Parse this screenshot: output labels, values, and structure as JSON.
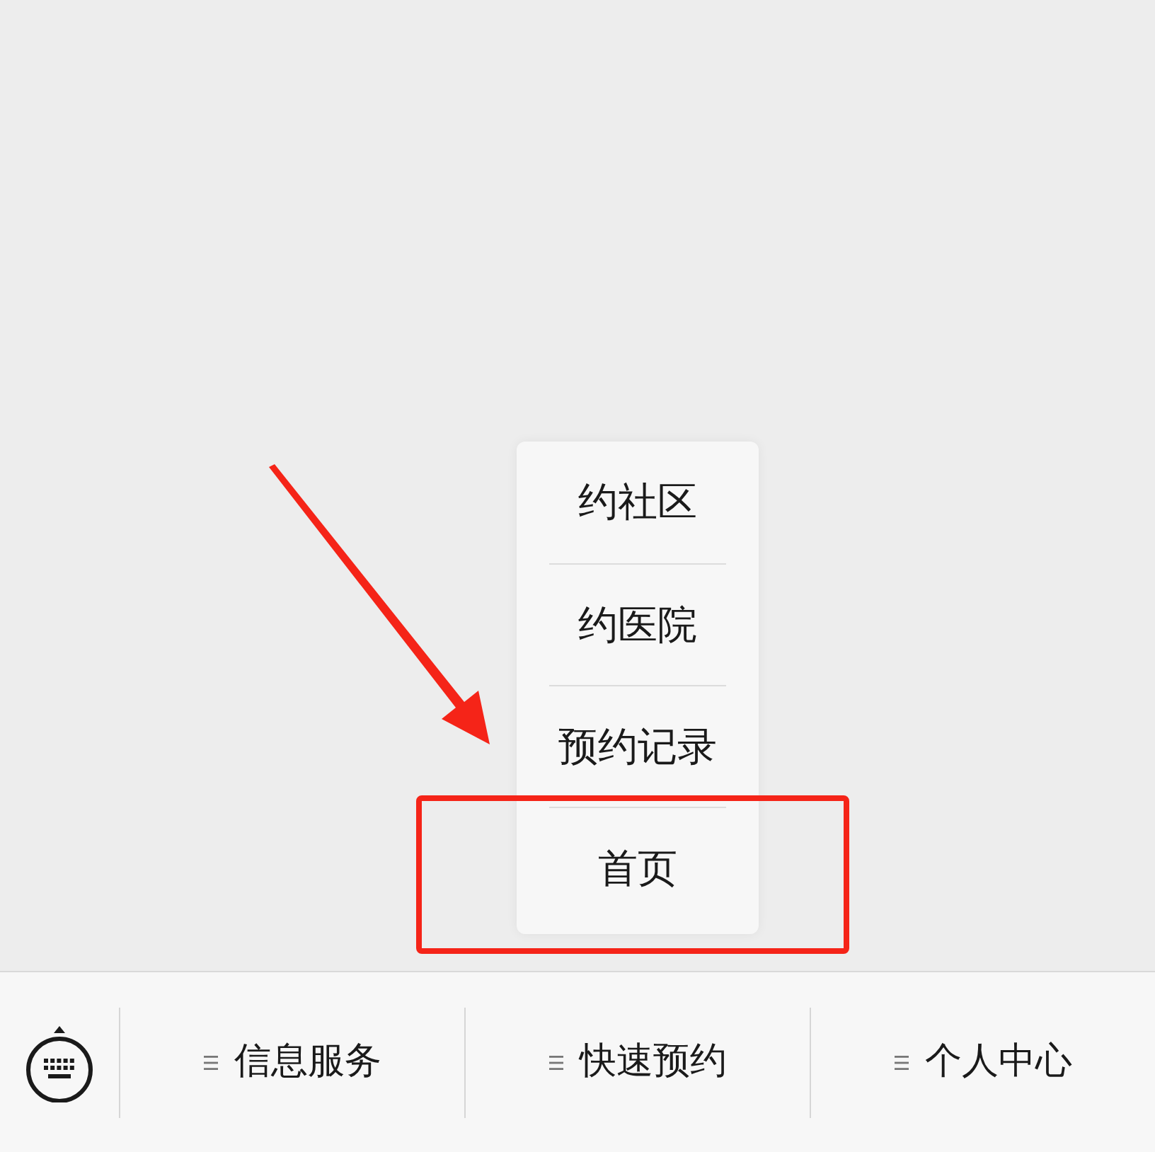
{
  "submenu": {
    "items": [
      {
        "label": "约社区"
      },
      {
        "label": "约医院"
      },
      {
        "label": "预约记录"
      },
      {
        "label": "首页"
      }
    ]
  },
  "menu_bar": {
    "tabs": [
      {
        "label": "信息服务"
      },
      {
        "label": "快速预约"
      },
      {
        "label": "个人中心"
      }
    ]
  }
}
